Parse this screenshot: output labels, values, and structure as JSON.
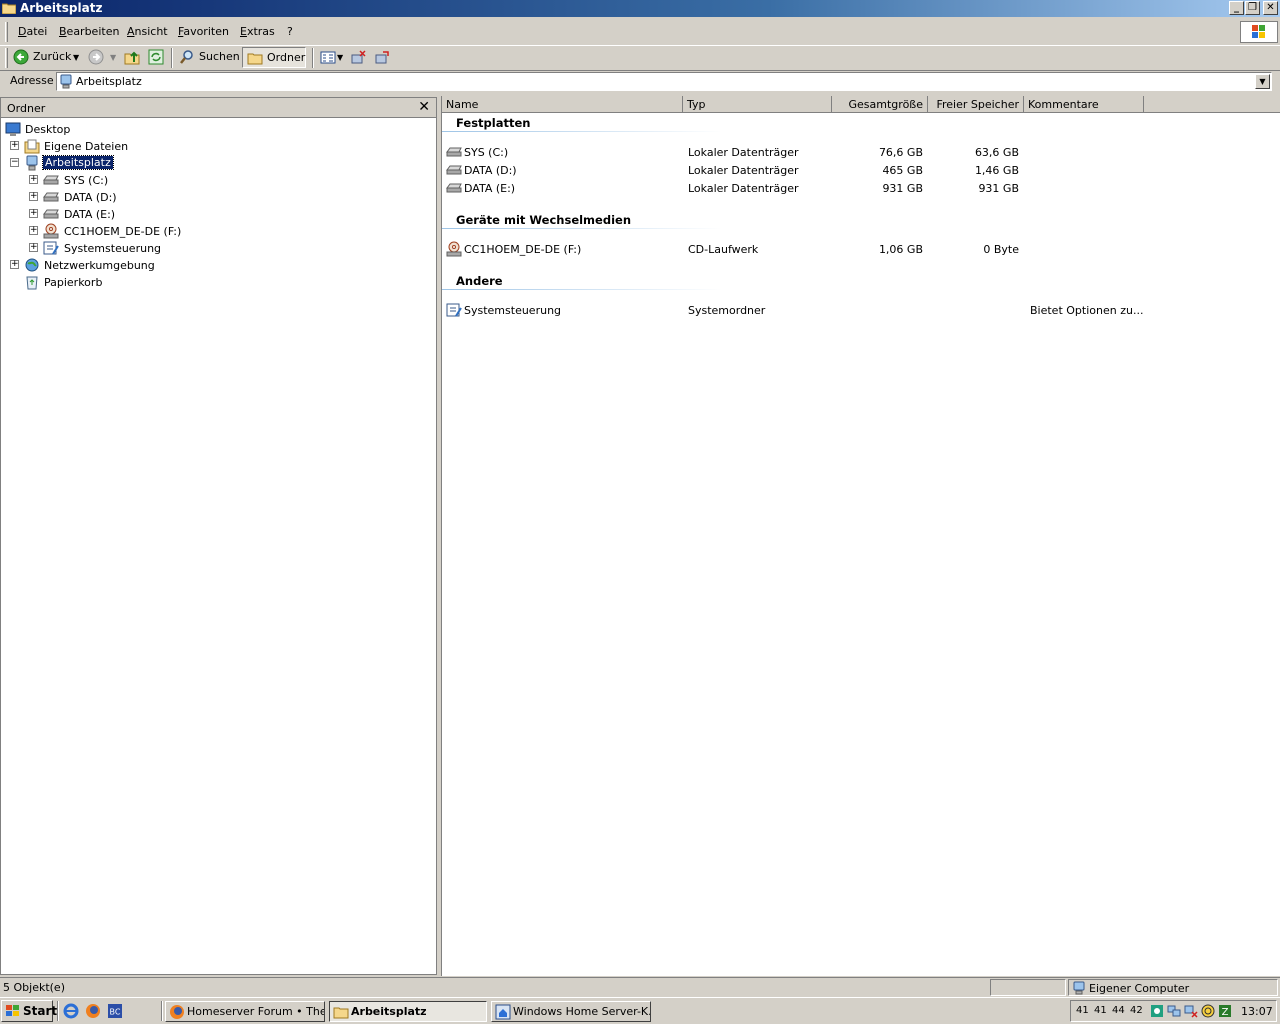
{
  "window": {
    "title": "Arbeitsplatz"
  },
  "menu": [
    "Datei",
    "Bearbeiten",
    "Ansicht",
    "Favoriten",
    "Extras",
    "?"
  ],
  "toolbar": {
    "back_label": "Zurück",
    "search_label": "Suchen",
    "folders_label": "Ordner"
  },
  "address": {
    "label": "Adresse",
    "value": "Arbeitsplatz"
  },
  "folder_pane": {
    "title": "Ordner",
    "tree": [
      {
        "label": "Desktop",
        "icon": "desktop-icon"
      },
      {
        "label": "Eigene Dateien",
        "icon": "documents-icon"
      },
      {
        "label": "Arbeitsplatz",
        "icon": "computer-icon"
      },
      {
        "label": "SYS (C:)",
        "icon": "drive-icon"
      },
      {
        "label": "DATA (D:)",
        "icon": "drive-icon"
      },
      {
        "label": "DATA (E:)",
        "icon": "drive-icon"
      },
      {
        "label": "CC1HOEM_DE-DE (F:)",
        "icon": "cd-drive-icon"
      },
      {
        "label": "Systemsteuerung",
        "icon": "control-panel-icon"
      },
      {
        "label": "Netzwerkumgebung",
        "icon": "network-icon"
      },
      {
        "label": "Papierkorb",
        "icon": "recycle-bin-icon"
      }
    ]
  },
  "list": {
    "columns": [
      "Name",
      "Typ",
      "Gesamtgröße",
      "Freier Speicher",
      "Kommentare"
    ],
    "groups": [
      {
        "title": "Festplatten",
        "rows": [
          {
            "name": "SYS (C:)",
            "type": "Lokaler Datenträger",
            "total": "76,6 GB",
            "free": "63,6 GB",
            "comment": ""
          },
          {
            "name": "DATA (D:)",
            "type": "Lokaler Datenträger",
            "total": "465 GB",
            "free": "1,46 GB",
            "comment": ""
          },
          {
            "name": "DATA (E:)",
            "type": "Lokaler Datenträger",
            "total": "931 GB",
            "free": "931 GB",
            "comment": ""
          }
        ]
      },
      {
        "title": "Geräte mit Wechselmedien",
        "rows": [
          {
            "name": "CC1HOEM_DE-DE (F:)",
            "type": "CD-Laufwerk",
            "total": "1,06 GB",
            "free": "0 Byte",
            "comment": ""
          }
        ]
      },
      {
        "title": "Andere",
        "rows": [
          {
            "name": "Systemsteuerung",
            "type": "Systemordner",
            "total": "",
            "free": "",
            "comment": "Bietet Optionen zu..."
          }
        ]
      }
    ]
  },
  "status": {
    "count": "5 Objekt(e)",
    "zone": "Eigener Computer"
  },
  "taskbar": {
    "start_label": "Start",
    "tasks": [
      "Homeserver Forum • The...",
      "Arbeitsplatz",
      "Windows Home Server-K..."
    ],
    "tray_numbers": [
      "41",
      "41",
      "44",
      "42"
    ],
    "clock": "13:07"
  }
}
